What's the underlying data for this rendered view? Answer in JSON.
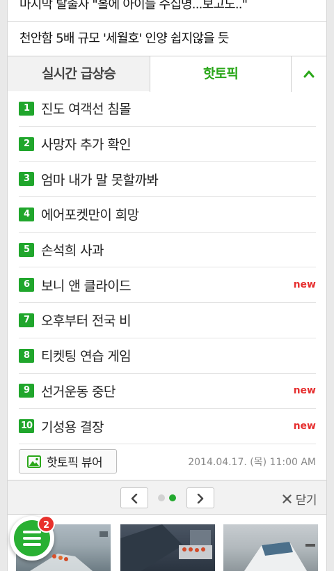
{
  "headlines": [
    "마지막 탈출자 \"홀에 아이들 수십명...보고도..\"",
    "천안함 5배 규모 '세월호' 인양 쉽지않을 듯"
  ],
  "tabs": {
    "realtime": "실시간 급상승",
    "hot": "핫토픽"
  },
  "hot_topics": [
    {
      "rank": "1",
      "keyword": "진도 여객선 침몰",
      "badge": ""
    },
    {
      "rank": "2",
      "keyword": "사망자 추가 확인",
      "badge": ""
    },
    {
      "rank": "3",
      "keyword": "엄마 내가 말 못할까봐",
      "badge": ""
    },
    {
      "rank": "4",
      "keyword": "에어포켓만이 희망",
      "badge": ""
    },
    {
      "rank": "5",
      "keyword": "손석희 사과",
      "badge": ""
    },
    {
      "rank": "6",
      "keyword": "보니 앤 클라이드",
      "badge": "new"
    },
    {
      "rank": "7",
      "keyword": "오후부터 전국 비",
      "badge": ""
    },
    {
      "rank": "8",
      "keyword": "티켓팅 연습 게임",
      "badge": ""
    },
    {
      "rank": "9",
      "keyword": "선거운동 중단",
      "badge": "new"
    },
    {
      "rank": "10",
      "keyword": "기성용 결장",
      "badge": "new"
    }
  ],
  "viewer_button": "핫토픽 뷰어",
  "timestamp": "2014.04.17. (목) 11:00 AM",
  "close_label": "닫기",
  "menu_badge_count": "2",
  "colors": {
    "accent_green": "#20a62c",
    "new_red": "#e63030",
    "badge_red": "#e8312c"
  },
  "icons": [
    "chevron-up-icon",
    "image-icon",
    "chevron-left-icon",
    "chevron-right-icon",
    "close-icon",
    "menu-icon"
  ]
}
